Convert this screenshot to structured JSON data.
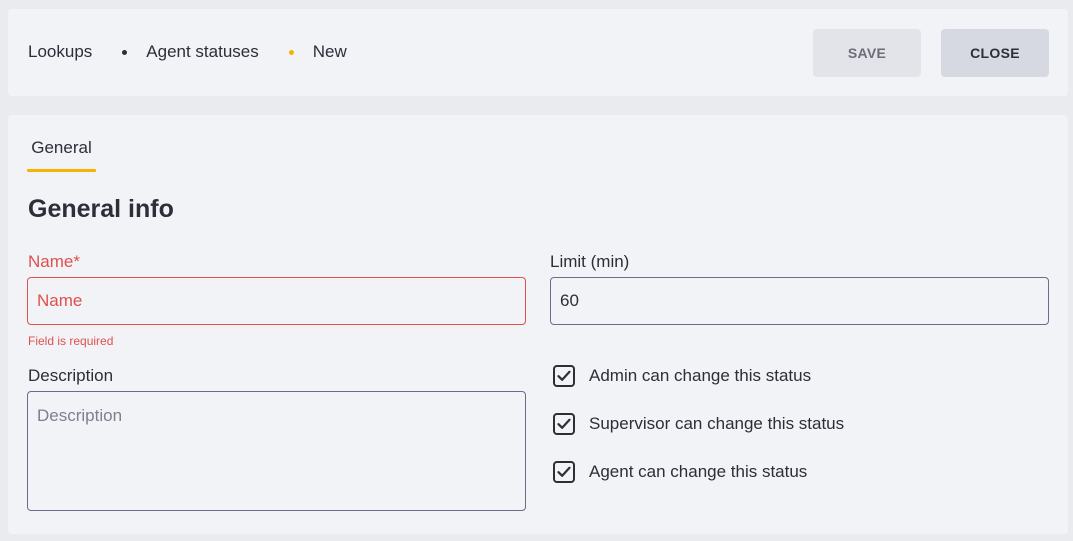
{
  "breadcrumb": {
    "items": [
      "Lookups",
      "Agent statuses",
      "New"
    ],
    "separator_colors": [
      "#2c2e38",
      "#f5b400"
    ]
  },
  "toolbar": {
    "save_label": "SAVE",
    "close_label": "CLOSE"
  },
  "tabs": [
    {
      "label": "General",
      "active": true
    }
  ],
  "section": {
    "title": "General info"
  },
  "form": {
    "name": {
      "label": "Name*",
      "placeholder": "Name",
      "value": "",
      "error": "Field is required"
    },
    "limit": {
      "label": "Limit (min)",
      "value": "60"
    },
    "description": {
      "label": "Description",
      "placeholder": "Description",
      "value": ""
    },
    "checkboxes": [
      {
        "label": "Admin can change this status",
        "checked": true
      },
      {
        "label": "Supervisor can change this status",
        "checked": true
      },
      {
        "label": "Agent can change this status",
        "checked": true
      }
    ]
  },
  "colors": {
    "accent": "#f5b400",
    "error": "#e0504c",
    "background": "#eaebef",
    "panel": "#f2f3f7",
    "icon_names": [
      "checkbox-checked-icon"
    ]
  }
}
